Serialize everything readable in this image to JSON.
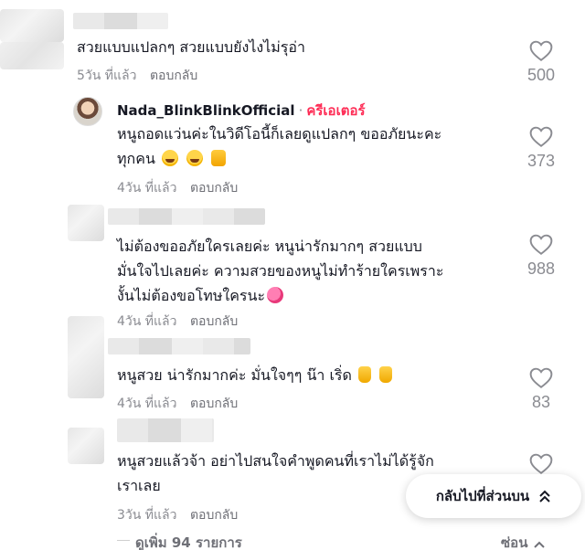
{
  "comments": [
    {
      "text_lines": [
        "สวยแบบแปลกๆ สวยแบบยังไงไม่รุอ่า"
      ],
      "time": "5วัน ที่แล้ว",
      "reply_label": "ตอบกลับ",
      "likes": "500"
    },
    {
      "author": "Nada_BlinkBlinkOfficial",
      "separator": "·",
      "badge": "ครีเอเตอร์",
      "text_lines": [
        "หนูถอดแว่นค่ะในวิดีโอนี้ก็เลยดูแปลกๆ ขออภัยนะคะ",
        "ทุกคน"
      ],
      "time": "4วัน ที่แล้ว",
      "reply_label": "ตอบกลับ",
      "likes": "373"
    },
    {
      "text_lines": [
        "ไม่ต้องขออภัยใครเลยค่ะ หนูน่ารักมากๆ สวยแบบ",
        "มั่นใจไปเลยค่ะ ความสวยของหนูไม่ทำร้ายใครเพราะ",
        "งั้นไม่ต้องขอโทษใครนะ"
      ],
      "time": "4วัน ที่แล้ว",
      "reply_label": "ตอบกลับ",
      "likes": "988"
    },
    {
      "text_lines": [
        "หนูสวย น่ารักมากค่ะ มั่นใจๆๆ น๊า เริ่ด"
      ],
      "time": "4วัน ที่แล้ว",
      "reply_label": "ตอบกลับ",
      "likes": "83"
    },
    {
      "text_lines": [
        "หนูสวยแล้วจ้า อย่าไปสนใจคำพูดคนที่เราไม่ได้รู้จัก",
        "เราเลย"
      ],
      "time": "3วัน ที่แล้ว",
      "reply_label": "ตอบกลับ"
    }
  ],
  "back_to_top_label": "กลับไปที่ส่วนบน",
  "view_more_label": "ดูเพิ่ม 94 รายการ",
  "hide_label": "ซ่อน",
  "icons": {
    "like": "heart-outline-icon",
    "back_to_top": "double-chevron-up-icon",
    "hide": "chevron-up-icon"
  }
}
